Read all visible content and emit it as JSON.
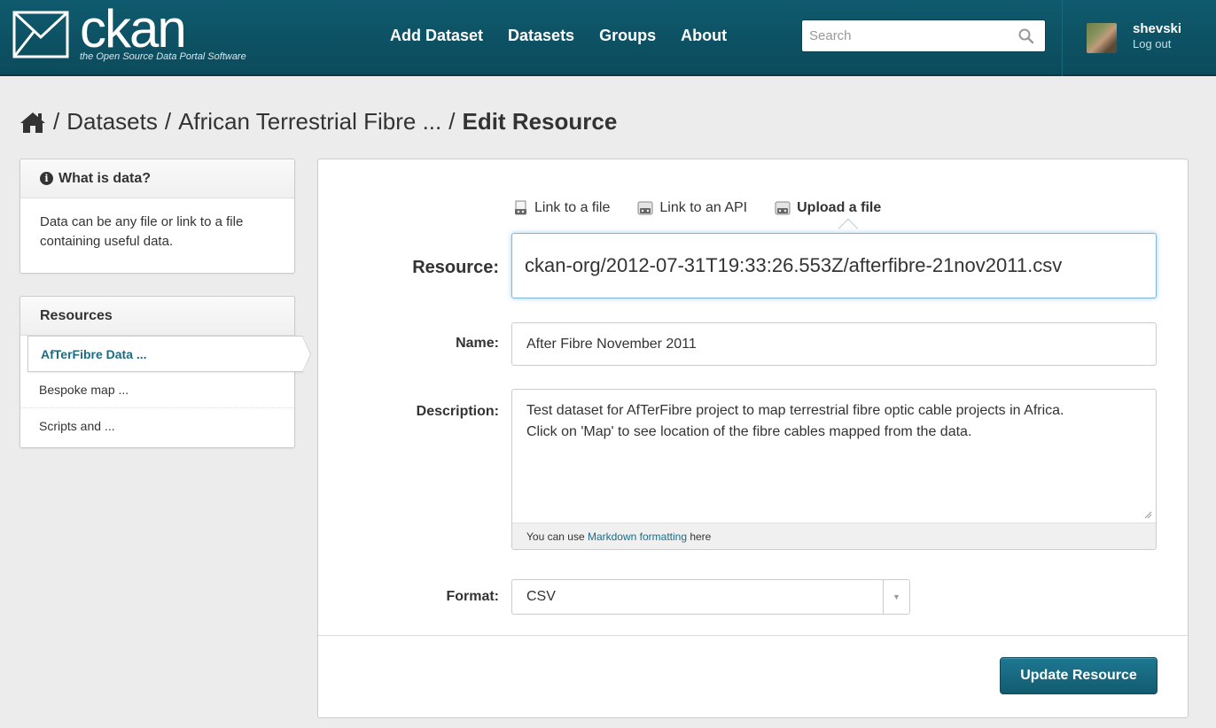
{
  "header": {
    "logo_text": "ckan",
    "logo_tagline": "the Open Source Data Portal Software",
    "nav": [
      "Add Dataset",
      "Datasets",
      "Groups",
      "About"
    ],
    "search_placeholder": "Search",
    "user_name": "shevski",
    "logout_label": "Log out",
    "brand_color": "#0f5a6d"
  },
  "breadcrumb": {
    "items": [
      "Datasets",
      "African Terrestrial Fibre ..."
    ],
    "current": "Edit Resource"
  },
  "sidebar": {
    "info_title": "What is data?",
    "info_body": "Data can be any file or link to a file containing useful data.",
    "resources_title": "Resources",
    "resources": [
      "AfTerFibre Data ...",
      "Bespoke map ...",
      "Scripts and ..."
    ]
  },
  "form": {
    "tabs": [
      "Link to a file",
      "Link to an API",
      "Upload a file"
    ],
    "active_tab": "Upload a file",
    "resource_label": "Resource:",
    "resource_value": "ckan-org/2012-07-31T19:33:26.553Z/afterfibre-21nov2011.csv",
    "name_label": "Name:",
    "name_value": "After Fibre November 2011",
    "description_label": "Description:",
    "description_line1": "Test dataset for AfTerFibre project to map terrestrial fibre optic cable projects in Africa.",
    "description_line2": "Click on 'Map' to see location of the fibre cables mapped from the data.",
    "markdown_hint_prefix": "You can use ",
    "markdown_link": "Markdown formatting",
    "markdown_hint_suffix": " here",
    "format_label": "Format:",
    "format_value": "CSV",
    "submit_label": "Update Resource"
  }
}
